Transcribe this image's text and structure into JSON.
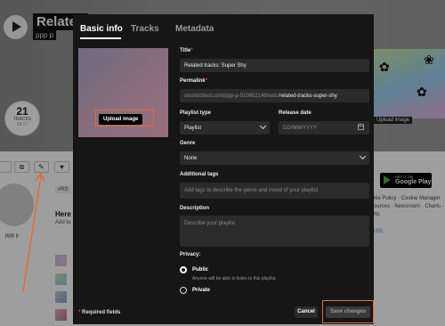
{
  "background": {
    "title": "Related",
    "username": "ppp p",
    "tracks_count": "21",
    "tracks_label": "TRACKS",
    "tracks_duration": "59:17",
    "upload_image": "Upload image",
    "tag": "#RS",
    "heading": "Here",
    "add_text": "Add ta",
    "avatar_name": "ppp p",
    "google_play_small": "GET IT ON",
    "google_play_big": "Google Play",
    "footer": [
      "kie Policy · Cookie Manager",
      "ources · Newsroom · Charts ·",
      "rts"
    ],
    "language": "US)"
  },
  "modal": {
    "tabs": [
      {
        "label": "Basic info",
        "active": true
      },
      {
        "label": "Tracks",
        "active": false
      },
      {
        "label": "Metadata",
        "active": false
      }
    ],
    "upload_image": "Upload image",
    "fields": {
      "title_label": "Title",
      "title_value": "Related tracks: Super Shy",
      "permalink_label": "Permalink",
      "permalink_prefix": "soundcloud.com/ppp-p-510652149/sets/",
      "permalink_value": "related-tracks-super-shy",
      "playlist_type_label": "Playlist type",
      "playlist_type_value": "Playlist",
      "release_date_label": "Release date",
      "release_date_placeholder": "DD/MM/YYYY",
      "genre_label": "Genre",
      "genre_value": "None",
      "tags_label": "Additional tags",
      "tags_placeholder": "Add tags to describe the genre and mood of your playlist",
      "description_label": "Description",
      "description_placeholder": "Describe your playlist",
      "privacy_label": "Privacy:"
    },
    "privacy": {
      "public_label": "Public",
      "public_sub": "Anyone will be able to listen to this playlist.",
      "private_label": "Private",
      "selected": "public"
    },
    "required_note": "Required fields",
    "required_mark": "*",
    "cancel": "Cancel",
    "save": "Save changes"
  },
  "colors": {
    "modal_bg": "#161616",
    "input_bg": "#2b2b2b",
    "highlight": "#e36a3a",
    "required": "#e64545"
  }
}
